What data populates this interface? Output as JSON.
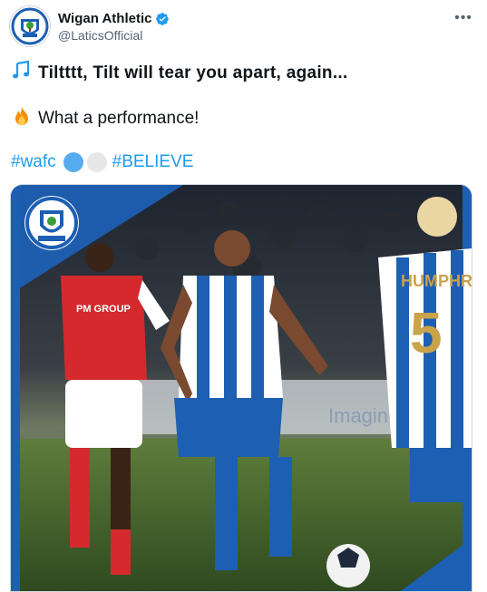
{
  "account": {
    "display_name": "Wigan Athletic",
    "handle": "@LaticsOfficial",
    "verified": true,
    "avatar_crest_text": "WIGAN ATHLETIC"
  },
  "more_label": "•••",
  "tweet": {
    "line1": "Tiltttt, Tilt will tear you apart, again...",
    "line1_emoji": "musical-notes-icon",
    "line2": "What a performance!",
    "line2_emoji": "fire-icon",
    "hashtag1": "#wafc",
    "hashtag2": "#BELIEVE",
    "circle_colors": [
      "#55acee",
      "#e6e7e8"
    ]
  },
  "media": {
    "crest_text": "WIGAN ATHLETIC",
    "sponsor_text": "PM GROUP",
    "player_name_partial": "HUMPHR",
    "shirt_number_partial": "5",
    "board_text": "Imagine Ca",
    "brand_color": "#1d5fb3",
    "opponent_color": "#d42a2e"
  }
}
